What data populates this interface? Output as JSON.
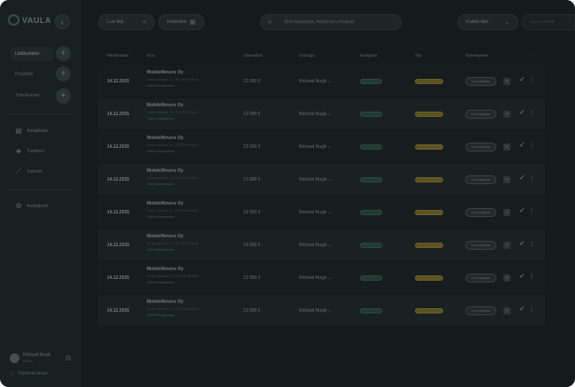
{
  "app": {
    "logo_text": "VAULA"
  },
  "sidebar": {
    "collapse_icon": "chevron-left-icon",
    "top_items": [
      {
        "label": "Liidiluettelo",
        "active": true
      },
      {
        "label": "Projektit",
        "active": false
      },
      {
        "label": "Toimitukset",
        "active": false
      }
    ],
    "nav": [
      {
        "label": "Asiakkaat",
        "icon": "clipboard-icon"
      },
      {
        "label": "Tuotteet",
        "icon": "cube-icon"
      },
      {
        "label": "Tuloset",
        "icon": "trend-icon"
      }
    ],
    "settings": {
      "label": "Asetukset",
      "icon": "gear-icon"
    },
    "user": {
      "name": "Richard Nuyjk",
      "role": "Admin"
    },
    "bottom_link": "Ohjelmat tässä"
  },
  "toolbar": {
    "filter1": "Luo liidi",
    "filter2": "Kalenteri",
    "search_placeholder": "Etsi kauppoja, liidejä tai yrityksiä",
    "dropdown": "Kaikki tilat",
    "ghost": "Luo uusi liidi"
  },
  "table": {
    "headers": [
      "Päivämäärä",
      "Nimi",
      "Liikevaihto",
      "Omistaja",
      "Kategoria",
      "Tila",
      "Toimenpiteet",
      "⋯"
    ],
    "rows": [
      {
        "date": "14.12.2025",
        "name": "MobileMovers Oy",
        "sub1": "Kaupunkikatu 12, 00100 Helsinki",
        "sub2": "Liidi kokoamassa",
        "sum": "12 000 €",
        "owner": "Richard Nuyjk",
        "action": "Luo kauppa"
      },
      {
        "date": "14.12.2025",
        "name": "MobileMovers Oy",
        "sub1": "Kaupunkikatu 12, 00100 Helsinki",
        "sub2": "Liidi kokoamassa",
        "sum": "12 000 €",
        "owner": "Richard Nuyjk",
        "action": "Luo kauppa"
      },
      {
        "date": "14.12.2025",
        "name": "MobileMovers Oy",
        "sub1": "Kaupunkikatu 12, 00100 Helsinki",
        "sub2": "Liidi kokoamassa",
        "sum": "12 000 €",
        "owner": "Richard Nuyjk",
        "action": "Luo kauppa"
      },
      {
        "date": "14.12.2025",
        "name": "MobileMovers Oy",
        "sub1": "Kaupunkikatu 12, 00100 Helsinki",
        "sub2": "Liidi kokoamassa",
        "sum": "12 000 €",
        "owner": "Richard Nuyjk",
        "action": "Luo kauppa"
      },
      {
        "date": "14.12.2025",
        "name": "MobileMovers Oy",
        "sub1": "Kaupunkikatu 12, 00100 Helsinki",
        "sub2": "Liidi kokoamassa",
        "sum": "12 000 €",
        "owner": "Richard Nuyjk",
        "action": "Luo kauppa"
      },
      {
        "date": "14.12.2025",
        "name": "MobileMovers Oy",
        "sub1": "Kaupunkikatu 12, 00100 Helsinki",
        "sub2": "Liidi kokoamassa",
        "sum": "12 000 €",
        "owner": "Richard Nuyjk",
        "action": "Luo kauppa"
      },
      {
        "date": "14.12.2025",
        "name": "MobileMovers Oy",
        "sub1": "Kaupunkikatu 12, 00100 Helsinki",
        "sub2": "Liidi kokoamassa",
        "sum": "12 000 €",
        "owner": "Richard Nuyjk",
        "action": "Luo kauppa"
      },
      {
        "date": "14.12.2025",
        "name": "MobileMovers Oy",
        "sub1": "Kaupunkikatu 12, 00100 Helsinki",
        "sub2": "Liidi kokoamassa",
        "sum": "12 000 €",
        "owner": "Richard Nuyjk",
        "action": "Luo kauppa"
      }
    ]
  },
  "colors": {
    "background": "#151b1d",
    "sidebar": "#192022",
    "status_green": "#203a31",
    "status_yellow": "#5a5220"
  }
}
